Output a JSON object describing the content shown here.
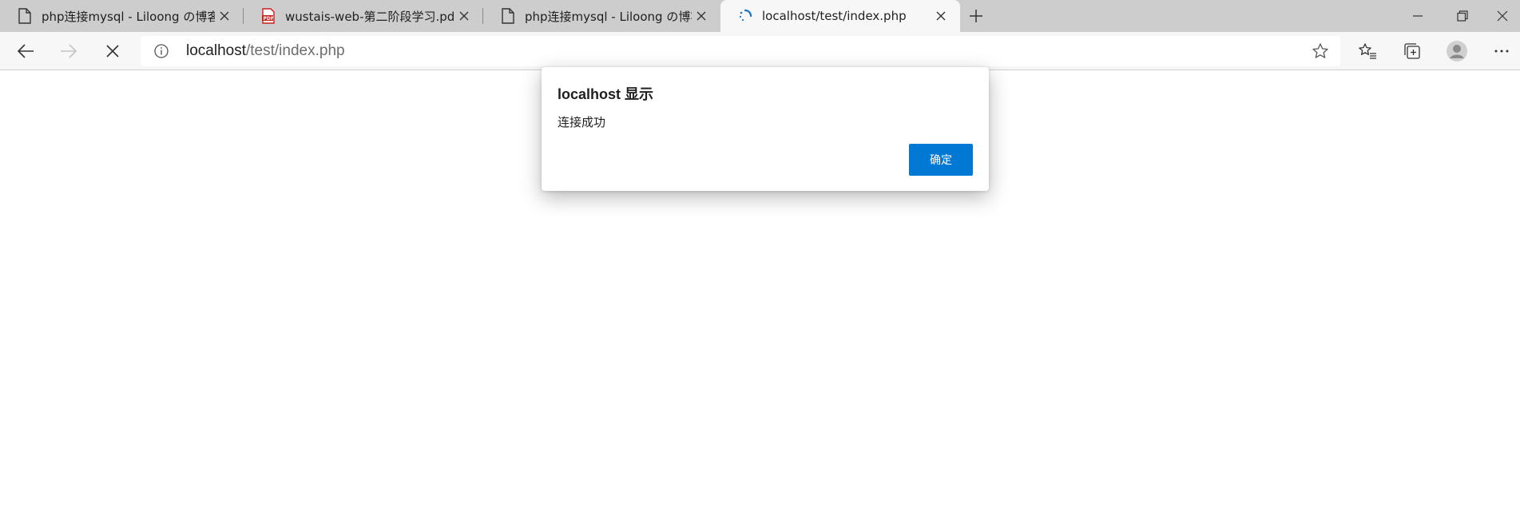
{
  "tabs": [
    {
      "title": "php连接mysql - Liloong の博客",
      "icon": "page-icon"
    },
    {
      "title": "wustais-web-第二阶段学习.pdf",
      "icon": "pdf-icon"
    },
    {
      "title": "php连接mysql - Liloong の博客",
      "icon": "page-icon"
    },
    {
      "title": "localhost/test/index.php",
      "icon": "loading-spinner-icon",
      "active": true
    }
  ],
  "toolbar": {
    "url_host": "localhost",
    "url_path": "/test/index.php"
  },
  "dialog": {
    "title": "localhost 显示",
    "message": "连接成功",
    "ok_label": "确定"
  },
  "colors": {
    "tabstrip_bg": "#cdcdcd",
    "toolbar_bg": "#f7f7f7",
    "accent": "#0078d4",
    "pdf_red": "#c8201b",
    "spinner_blue": "#1a73c9"
  }
}
